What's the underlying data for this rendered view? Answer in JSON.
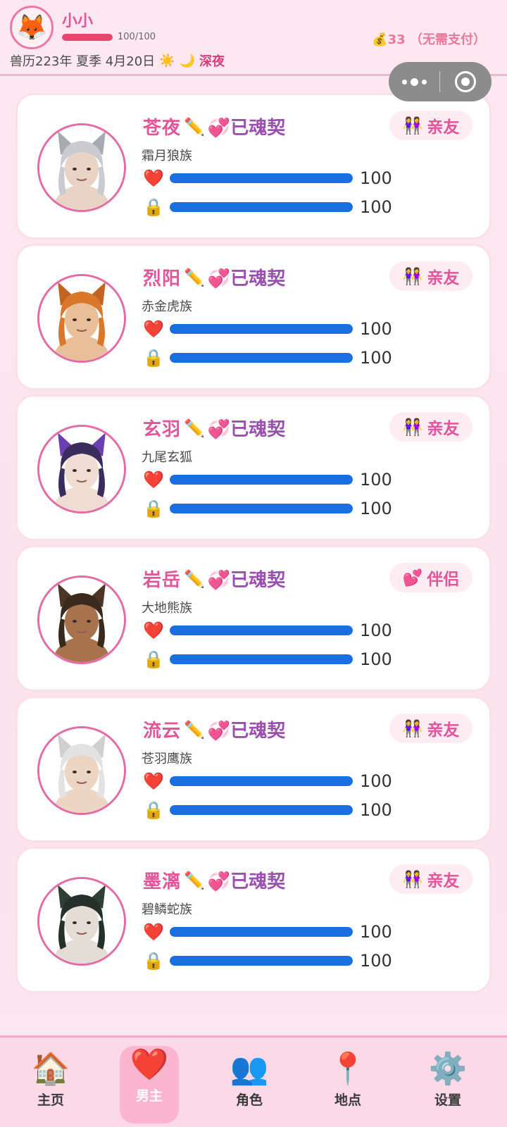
{
  "header": {
    "username": "小小",
    "hp_text": "100/100",
    "hp_fraction": 1.0,
    "date_text": "兽历223年 夏季 4月20日",
    "weather_icon": "☀️",
    "moon_icon": "🌙",
    "time_period": "深夜",
    "coin_icon": "💰",
    "coin_amount": "33",
    "coin_note": "（无需支付）",
    "avatar_icon": "🦊"
  },
  "characters": [
    {
      "name": "苍夜",
      "edit_icon": "✏️",
      "soul_icon": "💞",
      "soul_label": "已魂契",
      "relation_icon": "👭",
      "relation": "亲友",
      "tribe": "霜月狼族",
      "affection_icon": "❤️",
      "affection": "100",
      "lock_icon": "🔒",
      "lock": "100",
      "hair": "#c9cbd1",
      "ear": "#a8aab2",
      "skin": "#e9d3c4"
    },
    {
      "name": "烈阳",
      "edit_icon": "✏️",
      "soul_icon": "💞",
      "soul_label": "已魂契",
      "relation_icon": "👭",
      "relation": "亲友",
      "tribe": "赤金虎族",
      "affection_icon": "❤️",
      "affection": "100",
      "lock_icon": "🔒",
      "lock": "100",
      "hair": "#d9772b",
      "ear": "#c26422",
      "skin": "#e8bf98"
    },
    {
      "name": "玄羽",
      "edit_icon": "✏️",
      "soul_icon": "💞",
      "soul_label": "已魂契",
      "relation_icon": "👭",
      "relation": "亲友",
      "tribe": "九尾玄狐",
      "affection_icon": "❤️",
      "affection": "100",
      "lock_icon": "🔒",
      "lock": "100",
      "hair": "#3b2c5e",
      "ear": "#6a3fb0",
      "skin": "#efdcd2"
    },
    {
      "name": "岩岳",
      "edit_icon": "✏️",
      "soul_icon": "💞",
      "soul_label": "已魂契",
      "relation_icon": "💕",
      "relation": "伴侣",
      "tribe": "大地熊族",
      "affection_icon": "❤️",
      "affection": "100",
      "lock_icon": "🔒",
      "lock": "100",
      "hair": "#3a2a1e",
      "ear": "#4a3526",
      "skin": "#a8734c"
    },
    {
      "name": "流云",
      "edit_icon": "✏️",
      "soul_icon": "💞",
      "soul_label": "已魂契",
      "relation_icon": "👭",
      "relation": "亲友",
      "tribe": "苍羽鹰族",
      "affection_icon": "❤️",
      "affection": "100",
      "lock_icon": "🔒",
      "lock": "100",
      "hair": "#e2e2e2",
      "ear": "#cfcfcf",
      "skin": "#ecd5c3"
    },
    {
      "name": "墨漓",
      "edit_icon": "✏️",
      "soul_icon": "💞",
      "soul_label": "已魂契",
      "relation_icon": "👭",
      "relation": "亲友",
      "tribe": "碧鳞蛇族",
      "affection_icon": "❤️",
      "affection": "100",
      "lock_icon": "🔒",
      "lock": "100",
      "hair": "#24302a",
      "ear": "#2f3f36",
      "skin": "#e4ddd6"
    }
  ],
  "stats_fraction": 1.0,
  "nav": [
    {
      "icon": "🏠",
      "label": "主页",
      "active": false
    },
    {
      "icon": "❤️",
      "label": "男主",
      "active": true
    },
    {
      "icon": "👥",
      "label": "角色",
      "active": false
    },
    {
      "icon": "📍",
      "label": "地点",
      "active": false
    },
    {
      "icon": "⚙️",
      "label": "设置",
      "active": false
    }
  ]
}
